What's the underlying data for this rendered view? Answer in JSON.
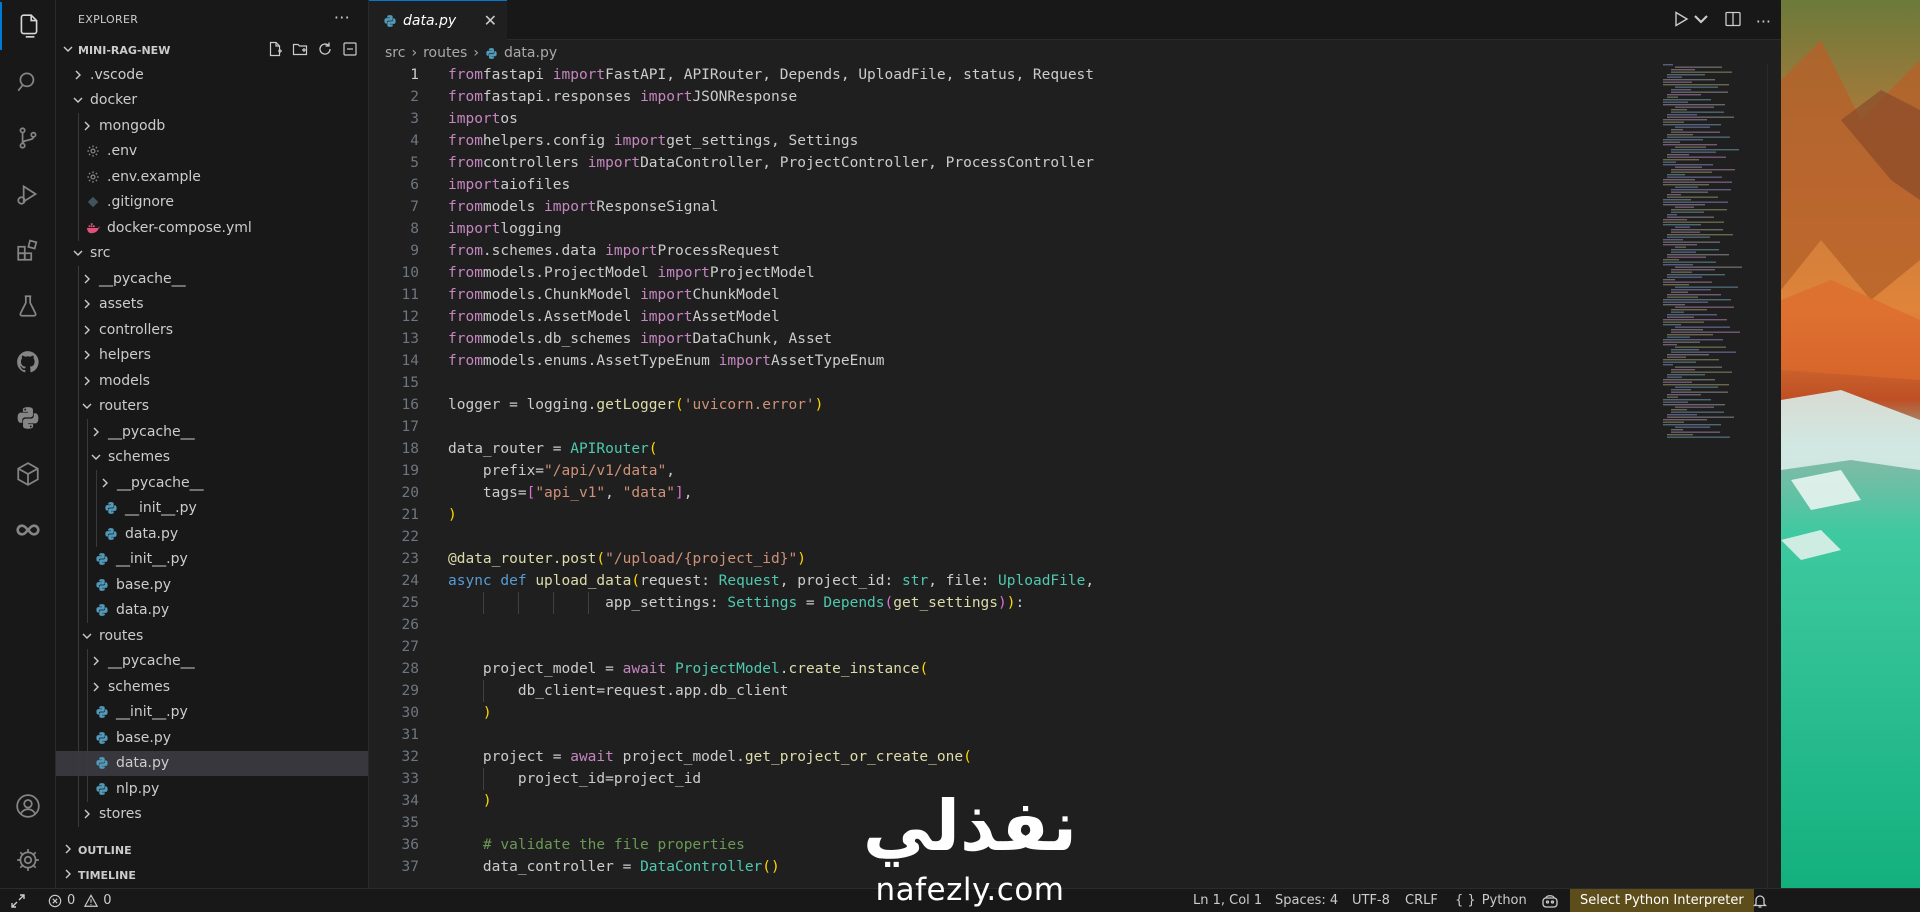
{
  "sidebar": {
    "title": "EXPLORER",
    "more": "···",
    "project": "MINI-RAG-NEW",
    "tree": [
      {
        "label": ".vscode",
        "type": "folder",
        "open": false,
        "depth": 0
      },
      {
        "label": "docker",
        "type": "folder",
        "open": true,
        "depth": 0
      },
      {
        "label": "mongodb",
        "type": "folder",
        "open": false,
        "depth": 1
      },
      {
        "label": ".env",
        "type": "gear",
        "depth": 1
      },
      {
        "label": ".env.example",
        "type": "gear",
        "depth": 1
      },
      {
        "label": ".gitignore",
        "type": "git",
        "depth": 1
      },
      {
        "label": "docker-compose.yml",
        "type": "docker",
        "depth": 1
      },
      {
        "label": "src",
        "type": "folder",
        "open": true,
        "depth": 0
      },
      {
        "label": "__pycache__",
        "type": "folder",
        "open": false,
        "depth": 1
      },
      {
        "label": "assets",
        "type": "folder",
        "open": false,
        "depth": 1
      },
      {
        "label": "controllers",
        "type": "folder",
        "open": false,
        "depth": 1
      },
      {
        "label": "helpers",
        "type": "folder",
        "open": false,
        "depth": 1
      },
      {
        "label": "models",
        "type": "folder",
        "open": false,
        "depth": 1
      },
      {
        "label": "routers",
        "type": "folder",
        "open": true,
        "depth": 1
      },
      {
        "label": "__pycache__",
        "type": "folder",
        "open": false,
        "depth": 2
      },
      {
        "label": "schemes",
        "type": "folder",
        "open": true,
        "depth": 2
      },
      {
        "label": "__pycache__",
        "type": "folder",
        "open": false,
        "depth": 3
      },
      {
        "label": "__init__.py",
        "type": "python",
        "depth": 3
      },
      {
        "label": "data.py",
        "type": "python",
        "depth": 3
      },
      {
        "label": "__init__.py",
        "type": "python",
        "depth": 2
      },
      {
        "label": "base.py",
        "type": "python",
        "depth": 2
      },
      {
        "label": "data.py",
        "type": "python",
        "depth": 2
      },
      {
        "label": "routes",
        "type": "folder",
        "open": true,
        "depth": 1
      },
      {
        "label": "__pycache__",
        "type": "folder",
        "open": false,
        "depth": 2
      },
      {
        "label": "schemes",
        "type": "folder",
        "open": false,
        "depth": 2
      },
      {
        "label": "__init__.py",
        "type": "python",
        "depth": 2
      },
      {
        "label": "base.py",
        "type": "python",
        "depth": 2
      },
      {
        "label": "data.py",
        "type": "python",
        "depth": 2,
        "selected": true
      },
      {
        "label": "nlp.py",
        "type": "python",
        "depth": 2
      },
      {
        "label": "stores",
        "type": "folder",
        "open": false,
        "depth": 1
      }
    ],
    "outline": "OUTLINE",
    "timeline": "TIMELINE"
  },
  "tab": {
    "name": "data.py",
    "close": "✕"
  },
  "breadcrumb": {
    "part1": "src",
    "part2": "routes",
    "part3": "data.py",
    "sep": "›"
  },
  "code": [
    [
      [
        "kw",
        "from"
      ],
      [
        "",
        "fastapi "
      ],
      [
        "kw",
        "import"
      ],
      [
        "",
        "FastAPI, APIRouter, Depends, UploadFile, status, Request"
      ]
    ],
    [
      [
        "kw",
        "from"
      ],
      [
        "",
        "fastapi.responses "
      ],
      [
        "kw",
        "import"
      ],
      [
        "",
        "JSONResponse"
      ]
    ],
    [
      [
        "kw",
        "import"
      ],
      [
        "",
        "os"
      ]
    ],
    [
      [
        "kw",
        "from"
      ],
      [
        "",
        "helpers.config "
      ],
      [
        "kw",
        "import"
      ],
      [
        "",
        "get_settings, Settings"
      ]
    ],
    [
      [
        "kw",
        "from"
      ],
      [
        "",
        "controllers "
      ],
      [
        "kw",
        "import"
      ],
      [
        "",
        "DataController, ProjectController, ProcessController"
      ]
    ],
    [
      [
        "kw",
        "import"
      ],
      [
        "",
        "aiofiles"
      ]
    ],
    [
      [
        "kw",
        "from"
      ],
      [
        "",
        "models "
      ],
      [
        "kw",
        "import"
      ],
      [
        "",
        "ResponseSignal"
      ]
    ],
    [
      [
        "kw",
        "import"
      ],
      [
        "",
        "logging"
      ]
    ],
    [
      [
        "kw",
        "from"
      ],
      [
        "",
        "."
      ],
      [
        "",
        "schemes.data "
      ],
      [
        "kw",
        "import"
      ],
      [
        "",
        "ProcessRequest"
      ]
    ],
    [
      [
        "kw",
        "from"
      ],
      [
        "",
        "models.ProjectModel "
      ],
      [
        "kw",
        "import"
      ],
      [
        "",
        "ProjectModel"
      ]
    ],
    [
      [
        "kw",
        "from"
      ],
      [
        "",
        "models.ChunkModel "
      ],
      [
        "kw",
        "import"
      ],
      [
        "",
        "ChunkModel"
      ]
    ],
    [
      [
        "kw",
        "from"
      ],
      [
        "",
        "models.AssetModel "
      ],
      [
        "kw",
        "import"
      ],
      [
        "",
        "AssetModel"
      ]
    ],
    [
      [
        "kw",
        "from"
      ],
      [
        "",
        "models.db_schemes "
      ],
      [
        "kw",
        "import"
      ],
      [
        "",
        "DataChunk, Asset"
      ]
    ],
    [
      [
        "kw",
        "from"
      ],
      [
        "",
        "models.enums.AssetTypeEnum "
      ],
      [
        "kw",
        "import"
      ],
      [
        "",
        "AssetTypeEnum"
      ]
    ],
    [],
    [
      [
        "",
        "logger = logging."
      ],
      [
        "fn",
        "getLogger"
      ],
      [
        "br",
        "("
      ],
      [
        "str",
        "'uvicorn.error'"
      ],
      [
        "br",
        ")"
      ]
    ],
    [],
    [
      [
        "",
        "data_router = "
      ],
      [
        "cls",
        "APIRouter"
      ],
      [
        "br",
        "("
      ]
    ],
    [
      [
        "",
        "    prefix="
      ],
      [
        "str",
        "\"/api/v1/data\""
      ],
      [
        "",
        ","
      ]
    ],
    [
      [
        "",
        "    tags="
      ],
      [
        "br2",
        "["
      ],
      [
        "str",
        "\"api_v1\""
      ],
      [
        "",
        ", "
      ],
      [
        "str",
        "\"data\""
      ],
      [
        "br2",
        "]"
      ],
      [
        "",
        ","
      ]
    ],
    [
      [
        "br",
        ")"
      ]
    ],
    [],
    [
      [
        "fn",
        "@data_router.post"
      ],
      [
        "br",
        "("
      ],
      [
        "str",
        "\"/upload/{project_id}\""
      ],
      [
        "br",
        ")"
      ]
    ],
    [
      [
        "kw2",
        "async"
      ],
      [
        "",
        " "
      ],
      [
        "kw2",
        "def"
      ],
      [
        "",
        " "
      ],
      [
        "fn",
        "upload_data"
      ],
      [
        "br",
        "("
      ],
      [
        "",
        "request: "
      ],
      [
        "cls",
        "Request"
      ],
      [
        "",
        ", project_id: "
      ],
      [
        "cls",
        "str"
      ],
      [
        "",
        ", file: "
      ],
      [
        "cls",
        "UploadFile"
      ],
      [
        "",
        ","
      ]
    ],
    [
      [
        "",
        "                  app_settings: "
      ],
      [
        "cls",
        "Settings"
      ],
      [
        "",
        " = "
      ],
      [
        "cls",
        "Depends"
      ],
      [
        "br2",
        "("
      ],
      [
        "fn",
        "get_settings"
      ],
      [
        "br2",
        ")"
      ],
      [
        "br",
        ")"
      ],
      [
        "",
        ":"
      ]
    ],
    [],
    [],
    [
      [
        "",
        "    project_model = "
      ],
      [
        "kw",
        "await"
      ],
      [
        "",
        " "
      ],
      [
        "cls",
        "ProjectModel"
      ],
      [
        "",
        "."
      ],
      [
        "fn",
        "create_instance"
      ],
      [
        "br",
        "("
      ]
    ],
    [
      [
        "",
        "        db_client=request.app.db_client"
      ]
    ],
    [
      [
        "",
        "    "
      ],
      [
        "br",
        ")"
      ]
    ],
    [],
    [
      [
        "",
        "    project = "
      ],
      [
        "kw",
        "await"
      ],
      [
        "",
        " project_model."
      ],
      [
        "fn",
        "get_project_or_create_one"
      ],
      [
        "br",
        "("
      ]
    ],
    [
      [
        "",
        "        project_id=project_id"
      ]
    ],
    [
      [
        "",
        "    "
      ],
      [
        "br",
        ")"
      ]
    ],
    [],
    [
      [
        "",
        "    "
      ],
      [
        "cmt",
        "# validate the file properties"
      ]
    ],
    [
      [
        "",
        "    data_controller = "
      ],
      [
        "cls",
        "DataController"
      ],
      [
        "br",
        "("
      ],
      [
        "br",
        ")"
      ]
    ]
  ],
  "statusbar": {
    "errors": "0",
    "warnings": "0",
    "position": "Ln 1, Col 1",
    "spaces": "Spaces: 4",
    "encoding": "UTF-8",
    "eol": "CRLF",
    "lang_braces": "{ }",
    "language": "Python",
    "interpreter": "Select Python Interpreter"
  },
  "watermark": {
    "arabic": "نفذلي",
    "latin": "nafezly.com"
  }
}
